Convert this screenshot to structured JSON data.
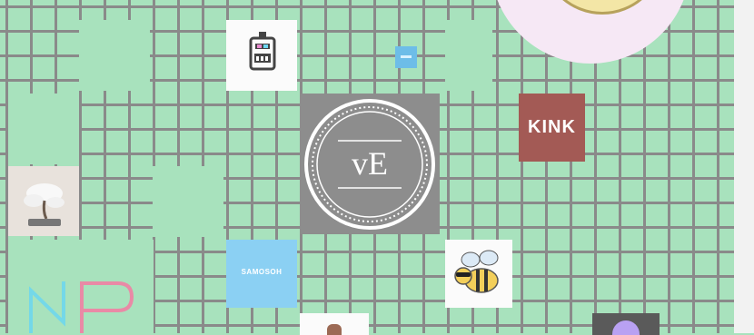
{
  "board": {
    "tiles": [
      {
        "name": "robot-tile",
        "kind": "robot-icon"
      },
      {
        "name": "small-blue-tile",
        "kind": "blue-block"
      },
      {
        "name": "monogram-tile",
        "text": "vE"
      },
      {
        "name": "kink-tile",
        "text": "KINK"
      },
      {
        "name": "bonsai-tile",
        "kind": "bonsai-photo"
      },
      {
        "name": "samosoh-tile",
        "text": "SAMOSOH"
      },
      {
        "name": "bee-tile",
        "kind": "bee-illustration"
      },
      {
        "name": "np-logo-tile",
        "kind": "neon-logo"
      }
    ]
  },
  "colors": {
    "board_bg": "#a8e2bd",
    "grid_line": "#8a8a8a",
    "monogram_bg": "#8d8d8d",
    "kink_bg": "#a35a55",
    "samosoh_bg": "#8bd0f3",
    "blue_block": "#6dbde8"
  }
}
